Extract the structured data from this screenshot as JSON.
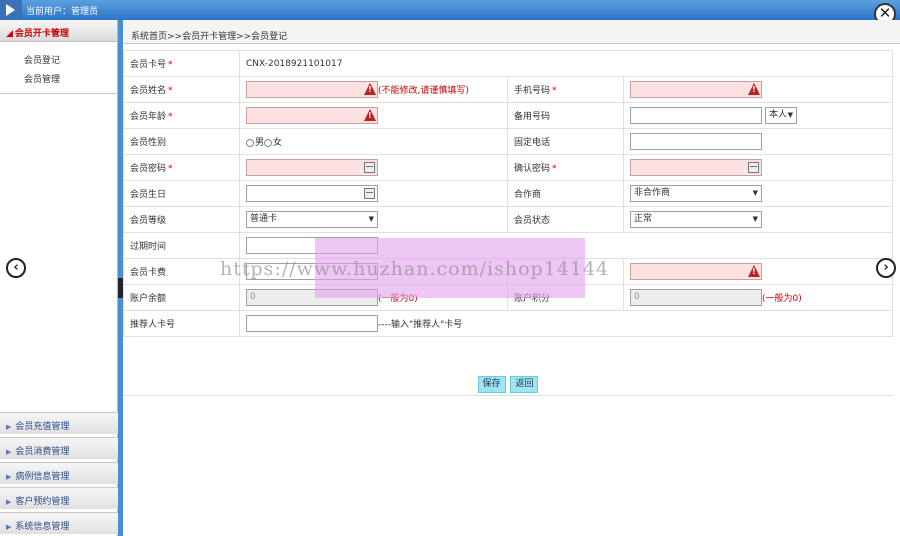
{
  "topbar": {
    "user_label": "当前用户：管理员",
    "close_icon": "close-icon",
    "logo_icon": "play-icon"
  },
  "sidebar": {
    "active_group": "会员开卡管理",
    "sub_items": [
      "会员登记",
      "会员管理"
    ],
    "groups": [
      "会员充值管理",
      "会员消费管理",
      "病例信息管理",
      "客户预约管理",
      "系统信息管理"
    ]
  },
  "breadcrumb": "系统首页>>会员开卡管理>>会员登记",
  "form": {
    "card_no": {
      "label": "会员卡号",
      "value": "CNX-2018921101017"
    },
    "name": {
      "label": "会员姓名",
      "hint": "(不能修改,请谨慎填写)"
    },
    "mobile": {
      "label": "手机号码"
    },
    "age": {
      "label": "会员年龄"
    },
    "backup_phone": {
      "label": "备用号码",
      "select": "本人"
    },
    "gender": {
      "label": "会员性别",
      "option_male": "男",
      "option_female": "女"
    },
    "landline": {
      "label": "固定电话"
    },
    "password": {
      "label": "会员密码"
    },
    "confirm_password": {
      "label": "确认密码"
    },
    "birthday": {
      "label": "会员生日"
    },
    "partner": {
      "label": "合作商",
      "select": "非合作商"
    },
    "level": {
      "label": "会员等级",
      "select": "普通卡"
    },
    "status": {
      "label": "会员状态",
      "select": "正常"
    },
    "expire": {
      "label": "过期时间"
    },
    "card_fee": {
      "label": "会员卡费"
    },
    "balance": {
      "label": "账户余额",
      "value": "0",
      "hint": "(一般为0)"
    },
    "points": {
      "label": "账户积分",
      "value": "0",
      "hint": "(一般为0)"
    },
    "referrer": {
      "label": "推荐人卡号",
      "hint": "----输入\"推荐人\"卡号"
    }
  },
  "buttons": {
    "save": "保存",
    "back": "返回"
  },
  "watermark": "https://www.huzhan.com/ishop14144",
  "nav": {
    "left_icon": "chevron-left-icon",
    "right_icon": "chevron-right-icon"
  }
}
